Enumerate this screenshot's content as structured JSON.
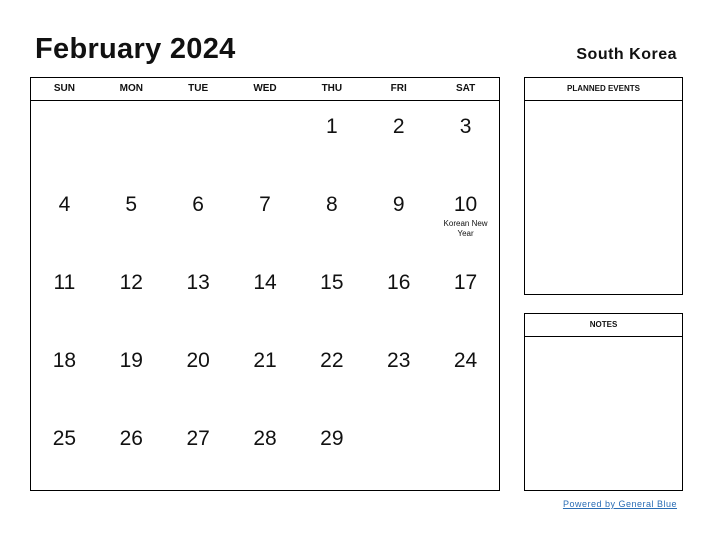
{
  "header": {
    "title": "February 2024",
    "country": "South Korea"
  },
  "weekdays": [
    "SUN",
    "MON",
    "TUE",
    "WED",
    "THU",
    "FRI",
    "SAT"
  ],
  "weeks": [
    [
      {
        "d": ""
      },
      {
        "d": ""
      },
      {
        "d": ""
      },
      {
        "d": ""
      },
      {
        "d": "1"
      },
      {
        "d": "2"
      },
      {
        "d": "3"
      }
    ],
    [
      {
        "d": "4"
      },
      {
        "d": "5"
      },
      {
        "d": "6"
      },
      {
        "d": "7"
      },
      {
        "d": "8"
      },
      {
        "d": "9"
      },
      {
        "d": "10",
        "event": "Korean New Year"
      }
    ],
    [
      {
        "d": "11"
      },
      {
        "d": "12"
      },
      {
        "d": "13"
      },
      {
        "d": "14"
      },
      {
        "d": "15"
      },
      {
        "d": "16"
      },
      {
        "d": "17"
      }
    ],
    [
      {
        "d": "18"
      },
      {
        "d": "19"
      },
      {
        "d": "20"
      },
      {
        "d": "21"
      },
      {
        "d": "22"
      },
      {
        "d": "23"
      },
      {
        "d": "24"
      }
    ],
    [
      {
        "d": "25"
      },
      {
        "d": "26"
      },
      {
        "d": "27"
      },
      {
        "d": "28"
      },
      {
        "d": "29"
      },
      {
        "d": ""
      },
      {
        "d": ""
      }
    ]
  ],
  "panels": {
    "planned_events": "PLANNED EVENTS",
    "notes": "NOTES"
  },
  "footer": {
    "powered_by": "Powered by General Blue",
    "link_color": "#2a6db5"
  }
}
